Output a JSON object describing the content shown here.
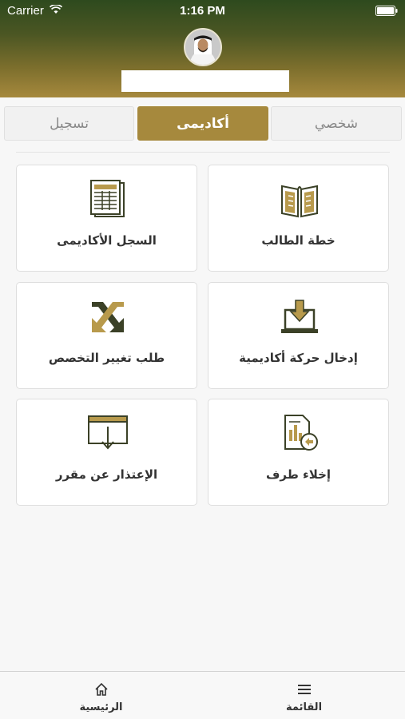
{
  "status_bar": {
    "carrier": "Carrier",
    "time": "1:16 PM"
  },
  "tabs": [
    {
      "label": "تسجيل"
    },
    {
      "label": "أكاديمى",
      "active": true
    },
    {
      "label": "شخصي"
    }
  ],
  "cards": [
    {
      "label": "خطة الطالب",
      "icon": "open-book-icon"
    },
    {
      "label": "السجل الأكاديمى",
      "icon": "document-table-icon"
    },
    {
      "label": "إدخال حركة أكاديمية",
      "icon": "laptop-download-icon"
    },
    {
      "label": "طلب تغيير التخصص",
      "icon": "swap-arrows-icon"
    },
    {
      "label": "إخلاء طرف",
      "icon": "report-return-icon"
    },
    {
      "label": "الإعتذار عن مقرر",
      "icon": "calendar-download-icon"
    }
  ],
  "bottom_bar": {
    "home_label": "الرئيسية",
    "menu_label": "القائمة"
  },
  "colors": {
    "accent": "#a6893d",
    "dark_green": "#2e4a1e",
    "icon_dark": "#3b4127"
  }
}
